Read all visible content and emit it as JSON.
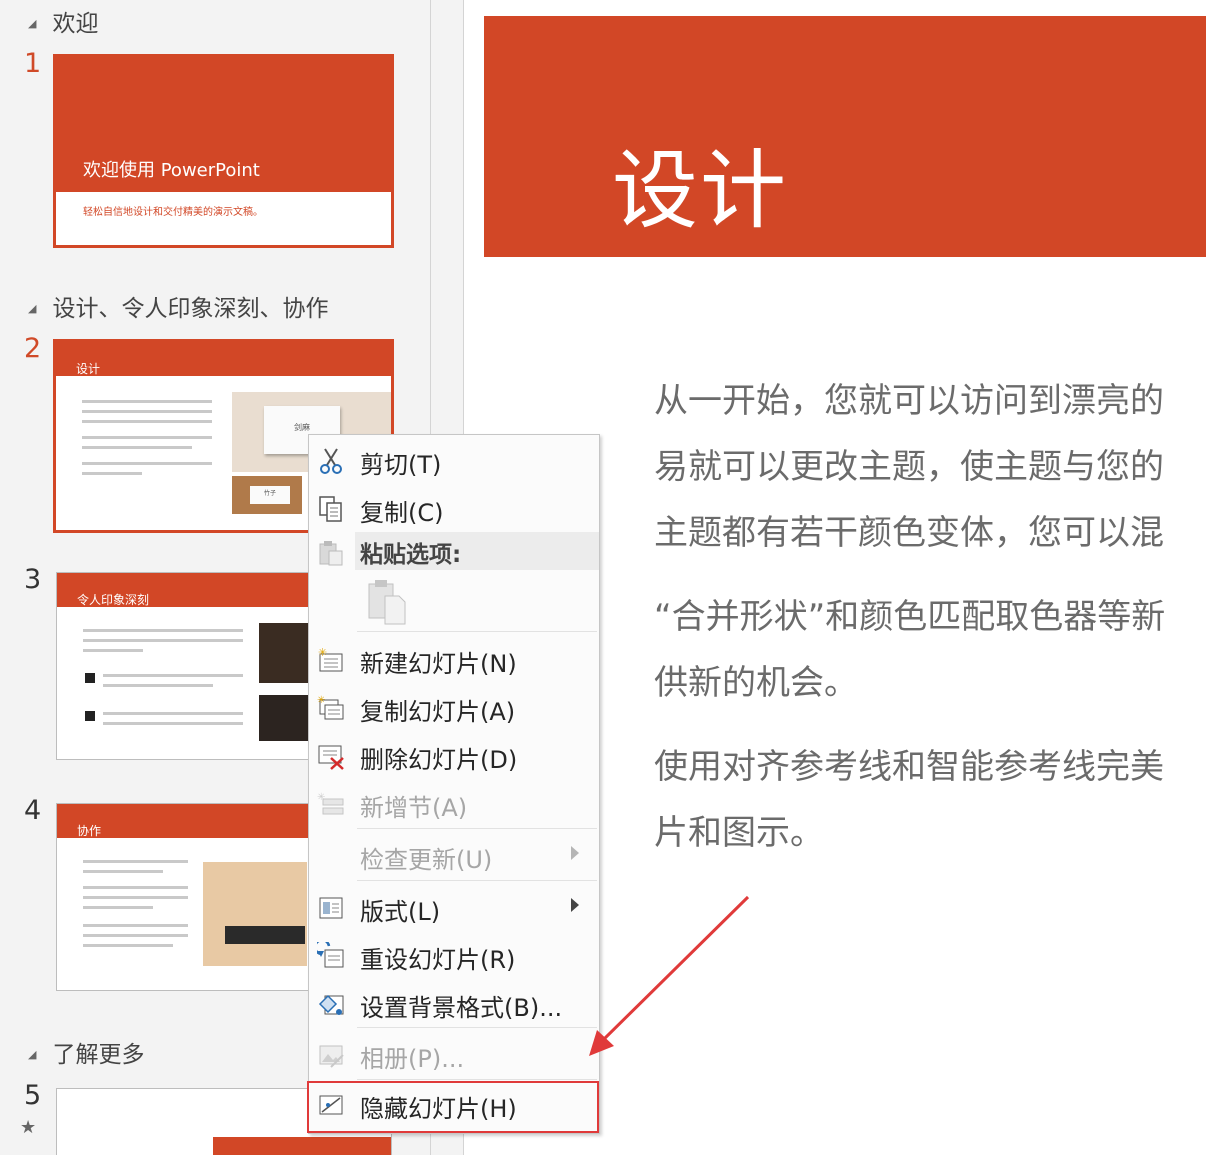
{
  "sections": [
    {
      "label": "欢迎"
    },
    {
      "label": "设计、令人印象深刻、协作"
    },
    {
      "label": "了解更多"
    }
  ],
  "slides": [
    {
      "number": "1",
      "title": "欢迎使用 PowerPoint",
      "subtitle": "轻松自信地设计和交付精美的演示文稿。"
    },
    {
      "number": "2",
      "title": "设计",
      "photo_caption_1": "剑麻",
      "photo_caption_2": "竹子"
    },
    {
      "number": "3",
      "title": "令人印象深刻"
    },
    {
      "number": "4",
      "title": "协作"
    },
    {
      "number": "5"
    }
  ],
  "main_slide": {
    "title": "设计",
    "paragraphs": [
      [
        "从一开始，您就可以访问到漂亮的",
        "易就可以更改主题，使主题与您的",
        "主题都有若干颜色变体，您可以混"
      ],
      [
        "“合并形状”和颜色匹配取色器等新",
        "供新的机会。"
      ],
      [
        "使用对齐参考线和智能参考线完美",
        "片和图示。"
      ]
    ]
  },
  "context_menu": {
    "cut": "剪切(T)",
    "copy": "复制(C)",
    "paste_options": "粘贴选项:",
    "new_slide": "新建幻灯片(N)",
    "duplicate_slide": "复制幻灯片(A)",
    "delete_slide": "删除幻灯片(D)",
    "add_section": "新增节(A)",
    "check_updates": "检查更新(U)",
    "layout": "版式(L)",
    "reset_slide": "重设幻灯片(R)",
    "format_background": "设置背景格式(B)...",
    "photo_album": "相册(P)...",
    "hide_slide": "隐藏幻灯片(H)"
  },
  "colors": {
    "accent": "#d24726",
    "annotation": "#e03a3a"
  },
  "icons": [
    "scissors-icon",
    "copy-icon",
    "paste-icon",
    "paste-keep-icon",
    "new-slide-icon",
    "duplicate-slide-icon",
    "delete-slide-icon",
    "add-section-icon",
    "layout-icon",
    "reset-slide-icon",
    "format-background-icon",
    "photo-album-icon",
    "hide-slide-icon",
    "star-icon"
  ]
}
